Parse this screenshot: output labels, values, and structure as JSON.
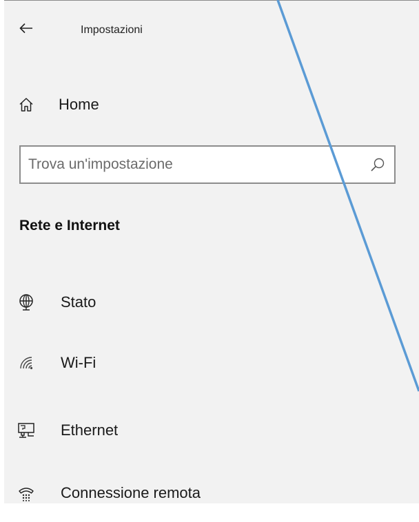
{
  "app": {
    "title": "Impostazioni"
  },
  "nav": {
    "back_icon": "arrow-left-icon",
    "home": {
      "label": "Home",
      "icon": "home-icon"
    }
  },
  "search": {
    "placeholder": "Trova un'impostazione",
    "value": "",
    "icon": "search-icon"
  },
  "section": {
    "heading": "Rete e Internet",
    "items": [
      {
        "label": "Stato",
        "icon": "globe-network-icon"
      },
      {
        "label": "Wi-Fi",
        "icon": "wifi-icon"
      },
      {
        "label": "Ethernet",
        "icon": "ethernet-icon"
      },
      {
        "label": "Connessione remota",
        "icon": "dialup-icon"
      }
    ]
  },
  "colors": {
    "background": "#f2f2f2",
    "annotation_line": "#5b9bd5"
  }
}
